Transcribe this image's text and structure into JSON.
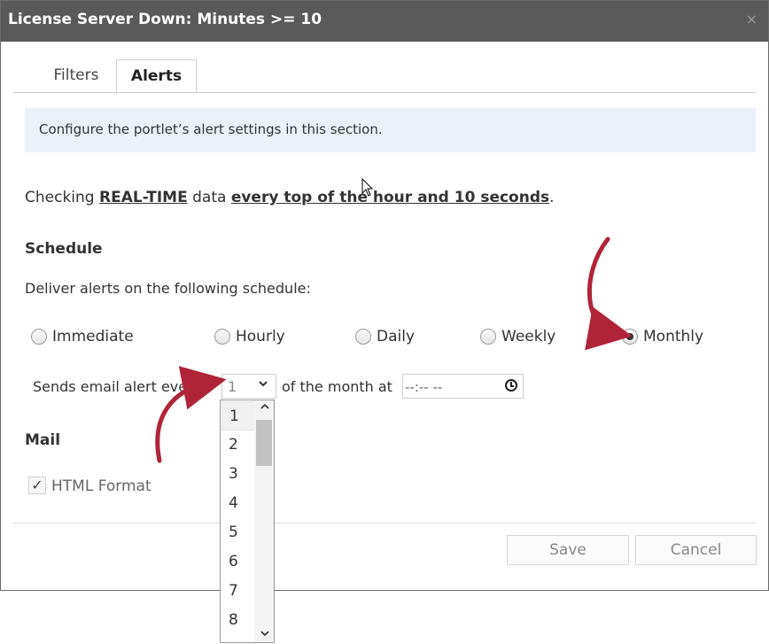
{
  "dialog": {
    "title": "License Server Down: Minutes >= 10",
    "close_glyph": "×",
    "close_icon": "close-icon"
  },
  "tabs": [
    {
      "label": "Filters",
      "active": false
    },
    {
      "label": "Alerts",
      "active": true
    }
  ],
  "info": {
    "text": "Configure the portlet’s alert settings in this section."
  },
  "checking": {
    "prefix": "Checking ",
    "mode": "REAL-TIME",
    "middle": " data ",
    "frequency": "every top of the hour and 10 seconds",
    "suffix": "."
  },
  "schedule": {
    "heading": "Schedule",
    "description": "Deliver alerts on the following schedule:",
    "options": [
      {
        "label": "Immediate",
        "selected": false
      },
      {
        "label": "Hourly",
        "selected": false
      },
      {
        "label": "Daily",
        "selected": false
      },
      {
        "label": "Weekly",
        "selected": false
      },
      {
        "label": "Monthly",
        "selected": true
      }
    ],
    "sends_label": "Sends email alert every",
    "day_value": "1",
    "day_chevron": "chevron-down-icon",
    "of_month_label": "of the month at",
    "time_value": "--:-- --",
    "time_icon": "clock-icon"
  },
  "dropdown": {
    "options": [
      "1",
      "2",
      "3",
      "4",
      "5",
      "6",
      "7",
      "8"
    ],
    "selected_index": 0,
    "scroll_up_glyph": "⌃",
    "scroll_down_glyph": "⌄"
  },
  "mail": {
    "heading": "Mail",
    "html_format_label": "HTML Format",
    "html_format_checked": true,
    "check_glyph": "✓"
  },
  "footer": {
    "save_label": "Save",
    "cancel_label": "Cancel"
  },
  "colors": {
    "titlebar": "#5a5a5a",
    "info_bg": "#eaf1f8",
    "annotation_arrow": "#b0243a"
  }
}
